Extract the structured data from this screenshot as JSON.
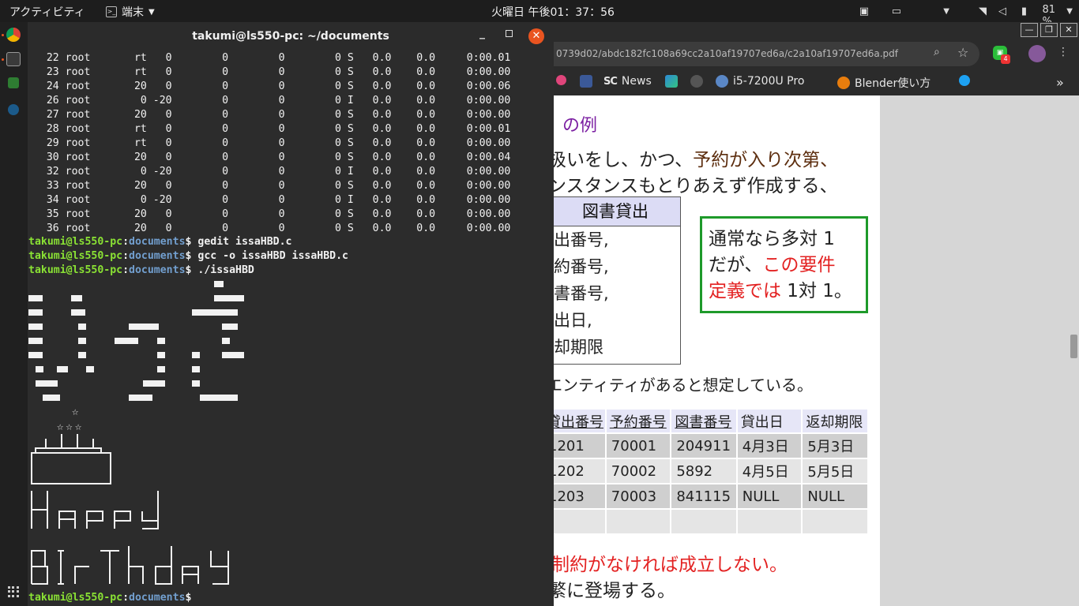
{
  "topbar": {
    "activities": "アクティビティ",
    "app_name": "端末",
    "clock": "火曜日 午後01：37：56",
    "battery": "81 %"
  },
  "terminal": {
    "title": "takumi@ls550-pc: ~/documents",
    "processes": [
      {
        "pid": "22",
        "user": "root",
        "pr": "rt",
        "ni": "0",
        "virt": "0",
        "res": "0",
        "shr": "0",
        "s": "S",
        "cpu": "0.0",
        "mem": "0.0",
        "time": "0:00.01"
      },
      {
        "pid": "23",
        "user": "root",
        "pr": "rt",
        "ni": "0",
        "virt": "0",
        "res": "0",
        "shr": "0",
        "s": "S",
        "cpu": "0.0",
        "mem": "0.0",
        "time": "0:00.00"
      },
      {
        "pid": "24",
        "user": "root",
        "pr": "20",
        "ni": "0",
        "virt": "0",
        "res": "0",
        "shr": "0",
        "s": "S",
        "cpu": "0.0",
        "mem": "0.0",
        "time": "0:00.06"
      },
      {
        "pid": "26",
        "user": "root",
        "pr": "0",
        "ni": "-20",
        "virt": "0",
        "res": "0",
        "shr": "0",
        "s": "I",
        "cpu": "0.0",
        "mem": "0.0",
        "time": "0:00.00"
      },
      {
        "pid": "27",
        "user": "root",
        "pr": "20",
        "ni": "0",
        "virt": "0",
        "res": "0",
        "shr": "0",
        "s": "S",
        "cpu": "0.0",
        "mem": "0.0",
        "time": "0:00.00"
      },
      {
        "pid": "28",
        "user": "root",
        "pr": "rt",
        "ni": "0",
        "virt": "0",
        "res": "0",
        "shr": "0",
        "s": "S",
        "cpu": "0.0",
        "mem": "0.0",
        "time": "0:00.01"
      },
      {
        "pid": "29",
        "user": "root",
        "pr": "rt",
        "ni": "0",
        "virt": "0",
        "res": "0",
        "shr": "0",
        "s": "S",
        "cpu": "0.0",
        "mem": "0.0",
        "time": "0:00.00"
      },
      {
        "pid": "30",
        "user": "root",
        "pr": "20",
        "ni": "0",
        "virt": "0",
        "res": "0",
        "shr": "0",
        "s": "S",
        "cpu": "0.0",
        "mem": "0.0",
        "time": "0:00.04"
      },
      {
        "pid": "32",
        "user": "root",
        "pr": "0",
        "ni": "-20",
        "virt": "0",
        "res": "0",
        "shr": "0",
        "s": "I",
        "cpu": "0.0",
        "mem": "0.0",
        "time": "0:00.00"
      },
      {
        "pid": "33",
        "user": "root",
        "pr": "20",
        "ni": "0",
        "virt": "0",
        "res": "0",
        "shr": "0",
        "s": "S",
        "cpu": "0.0",
        "mem": "0.0",
        "time": "0:00.00"
      },
      {
        "pid": "34",
        "user": "root",
        "pr": "0",
        "ni": "-20",
        "virt": "0",
        "res": "0",
        "shr": "0",
        "s": "I",
        "cpu": "0.0",
        "mem": "0.0",
        "time": "0:00.00"
      },
      {
        "pid": "35",
        "user": "root",
        "pr": "20",
        "ni": "0",
        "virt": "0",
        "res": "0",
        "shr": "0",
        "s": "S",
        "cpu": "0.0",
        "mem": "0.0",
        "time": "0:00.00"
      },
      {
        "pid": "36",
        "user": "root",
        "pr": "20",
        "ni": "0",
        "virt": "0",
        "res": "0",
        "shr": "0",
        "s": "S",
        "cpu": "0.0",
        "mem": "0.0",
        "time": "0:00.00"
      }
    ],
    "prompt_user": "takumi@ls550-pc",
    "prompt_path": "documents",
    "commands": [
      "gedit issaHBD.c",
      "gcc -o issaHBD issaHBD.c",
      "./issaHBD"
    ],
    "art_top_star": "☆",
    "art_stars": "☆☆☆"
  },
  "browser": {
    "url": "0739d02/abdc182fc108a69cc2a10af19707ed6a/c2a10af19707ed6a.pdf",
    "line_badge": "4",
    "bookmarks": [
      "News",
      "i5-7200U Pro",
      "Blender使い方"
    ],
    "more_bookmarks": "»",
    "slide": {
      "heading": "）の例",
      "line1_pre": "扱いをし、かつ、",
      "line1_hl": "予約が入り次第、",
      "line2": "ンスタンスもとりあえず作成する、",
      "entity_name": "図書貸出",
      "entity_attrs": [
        "出番号,",
        "約番号,",
        "書番号,",
        "出日,",
        "却期限"
      ],
      "note_l1": "通常なら多対 1",
      "note_l2_a": "だが、",
      "note_l2_b": "この要件",
      "note_l3_a": "定義では",
      "note_l3_b": " 1対 1。",
      "entity_note": "エンティティがあると想定している。",
      "table": {
        "headers": [
          "貸出番号",
          "予約番号",
          "図書番号",
          "貸出日",
          "返却期限"
        ],
        "rows": [
          [
            "1201",
            "70001",
            "204911",
            "4月3日",
            "5月3日"
          ],
          [
            "1202",
            "70002",
            "5892",
            "4月5日",
            "5月5日"
          ],
          [
            "1203",
            "70003",
            "841115",
            "NULL",
            "NULL"
          ],
          [
            "",
            "",
            "",
            "",
            ""
          ]
        ]
      },
      "bottom_red": "制約がなければ成立しない。",
      "bottom_black": "繁に登場する。"
    }
  }
}
